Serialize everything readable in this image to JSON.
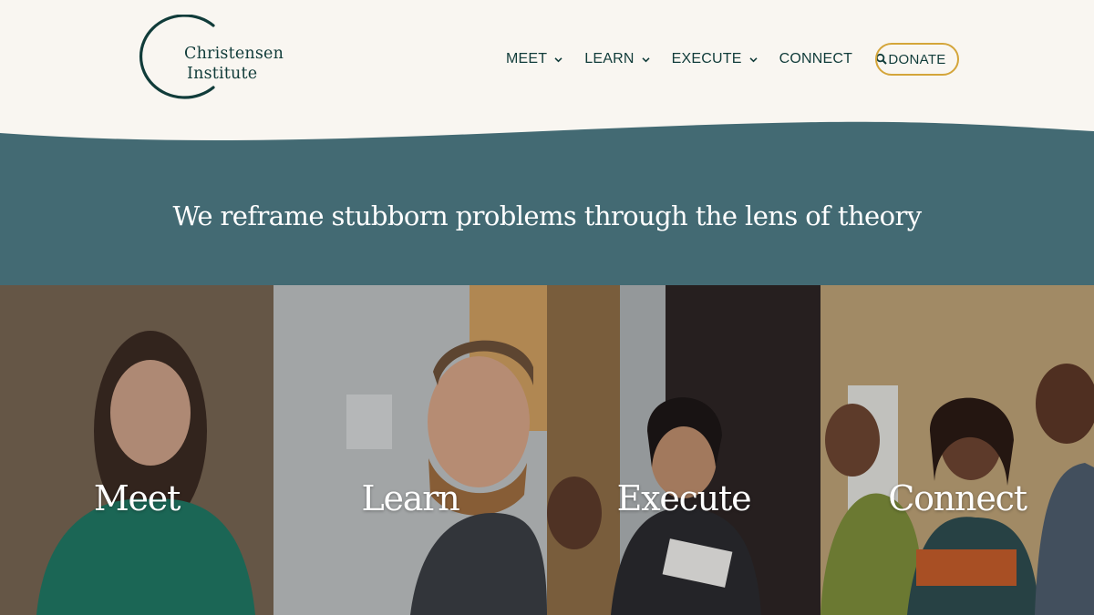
{
  "logo": {
    "line1": "Christensen",
    "line2": "Institute"
  },
  "nav": {
    "items": [
      {
        "label": "MEET",
        "has_dropdown": true
      },
      {
        "label": "LEARN",
        "has_dropdown": true
      },
      {
        "label": "EXECUTE",
        "has_dropdown": true
      },
      {
        "label": "CONNECT",
        "has_dropdown": false
      }
    ],
    "search_icon": "search-icon",
    "donate_label": "DONATE"
  },
  "hero": {
    "tagline": "We reframe stubborn problems through the lens of theory"
  },
  "tiles": [
    {
      "label": "Meet"
    },
    {
      "label": "Learn"
    },
    {
      "label": "Execute"
    },
    {
      "label": "Connect"
    }
  ],
  "colors": {
    "background": "#f9f6f1",
    "band": "#436a73",
    "brand_text": "#113c3a",
    "donate_border": "#d4a53a"
  }
}
